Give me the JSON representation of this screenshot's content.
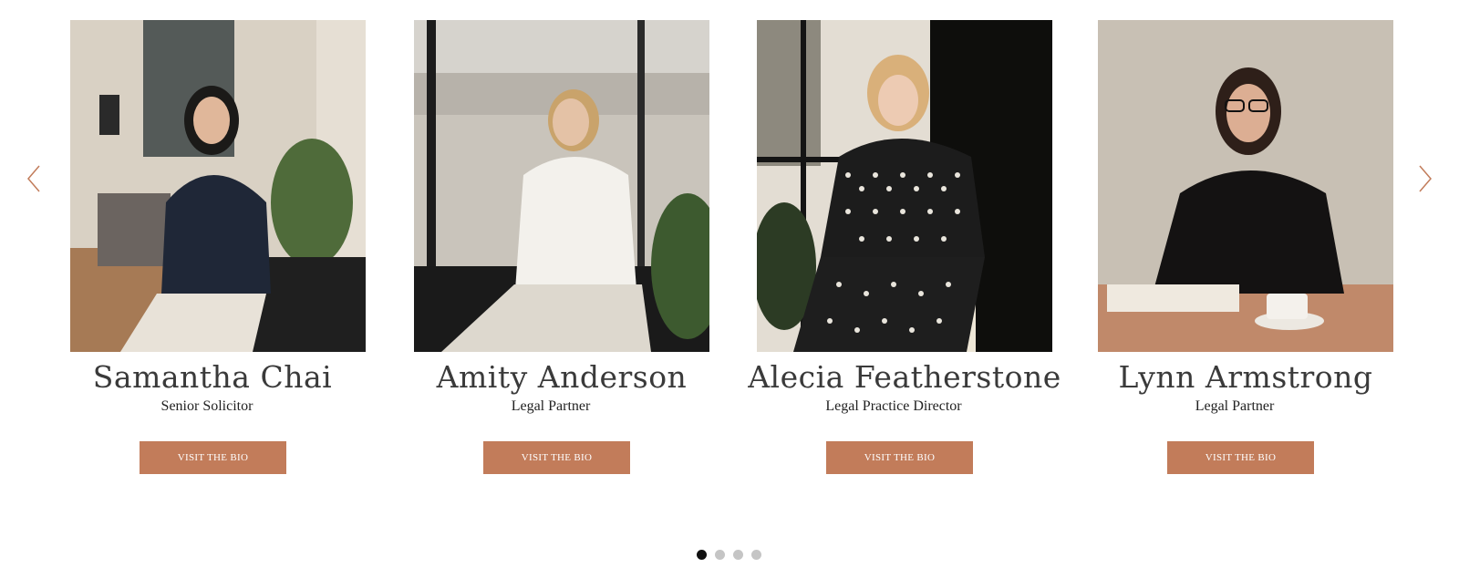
{
  "carousel": {
    "prev_icon": "chevron-left-icon",
    "next_icon": "chevron-right-icon",
    "accent_color": "#c27c5a",
    "active_dot": 1,
    "dot_count": 4,
    "people": [
      {
        "name": "Samantha Chai",
        "role": "Senior Solicitor",
        "button": "VISIT THE BIO",
        "photo": "portrait-photo"
      },
      {
        "name": "Amity Anderson",
        "role": "Legal Partner",
        "button": "VISIT THE BIO",
        "photo": "portrait-photo"
      },
      {
        "name": "Alecia Featherstone",
        "role": "Legal Practice Director",
        "button": "VISIT THE BIO",
        "photo": "portrait-photo"
      },
      {
        "name": "Lynn Armstrong",
        "role": "Legal Partner",
        "button": "VISIT THE BIO",
        "photo": "portrait-photo"
      }
    ]
  }
}
